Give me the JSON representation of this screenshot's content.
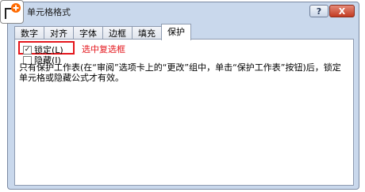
{
  "dialog": {
    "title": "单元格格式",
    "help_label": "?",
    "close_label": "X"
  },
  "tabs": [
    {
      "label": "数字"
    },
    {
      "label": "对齐"
    },
    {
      "label": "字体"
    },
    {
      "label": "边框"
    },
    {
      "label": "填充"
    },
    {
      "label": "保护",
      "active": true
    }
  ],
  "protection": {
    "lock_label": "锁定(L)",
    "lock_checked": true,
    "hide_label": "隐藏(I)",
    "hide_checked": false,
    "annotation": "选中复选框",
    "description": "只有保护工作表(在“审阅”选项卡上的“更改”组中，单击“保护工作表”按钮)后，锁定单元格或隐藏公式才有效。"
  },
  "colors": {
    "highlight": "#e4161c"
  }
}
